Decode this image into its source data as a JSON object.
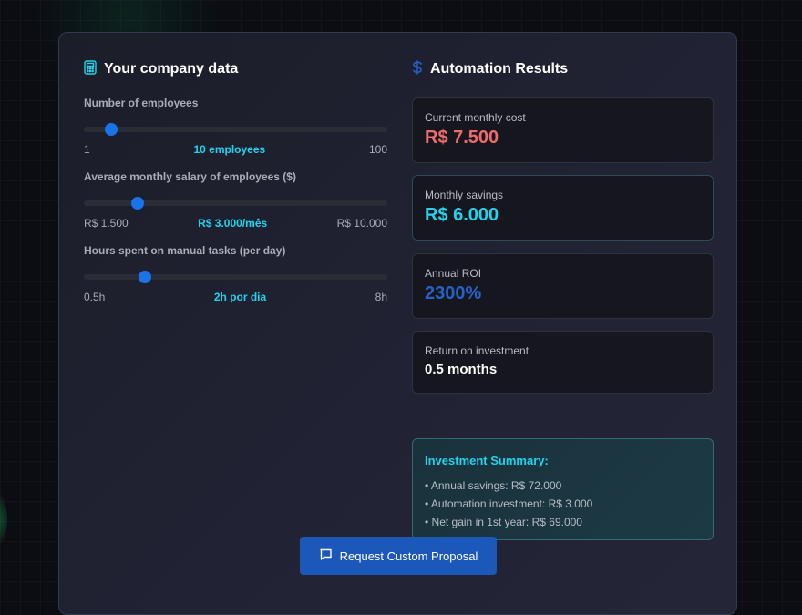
{
  "colors": {
    "accent_cyan": "#22d3ee",
    "accent_blue": "#1a73e8",
    "cost_red": "#f06b6b",
    "roi_blue": "#2563c9",
    "button_blue": "#1c58b9"
  },
  "left": {
    "title": "Your company data",
    "title_icon": "calculator-icon",
    "fields": [
      {
        "label": "Number of employees",
        "min_label": "1",
        "max_label": "100",
        "current_label": "10 employees",
        "min": 1,
        "max": 100,
        "value": 10
      },
      {
        "label": "Average monthly salary of employees ($)",
        "min_label": "R$ 1.500",
        "max_label": "R$ 10.000",
        "current_label": "R$ 3.000/mês",
        "min": 1500,
        "max": 10000,
        "value": 3000
      },
      {
        "label": "Hours spent on manual tasks (per day)",
        "min_label": "0.5h",
        "max_label": "8h",
        "current_label": "2h por dia",
        "min": 0.5,
        "max": 8,
        "value": 2
      }
    ]
  },
  "right": {
    "title": "Automation Results",
    "title_icon": "dollar-icon",
    "metrics": [
      {
        "label": "Current monthly cost",
        "value": "R$ 7.500",
        "color": "#f06b6b"
      },
      {
        "label": "Monthly savings",
        "value": "R$ 6.000",
        "color": "#22d3ee"
      },
      {
        "label": "Annual ROI",
        "value": "2300%",
        "color": "#2563c9"
      },
      {
        "label": "Return on investment",
        "value": "0.5 months",
        "color": "#ffffff"
      }
    ],
    "summary": {
      "title": "Investment Summary:",
      "items": [
        "• Annual savings: R$ 72.000",
        "• Automation investment: R$ 3.000",
        "• Net gain in 1st year: R$ 69.000"
      ]
    }
  },
  "cta": {
    "label": "Request Custom Proposal",
    "icon": "message-icon"
  }
}
